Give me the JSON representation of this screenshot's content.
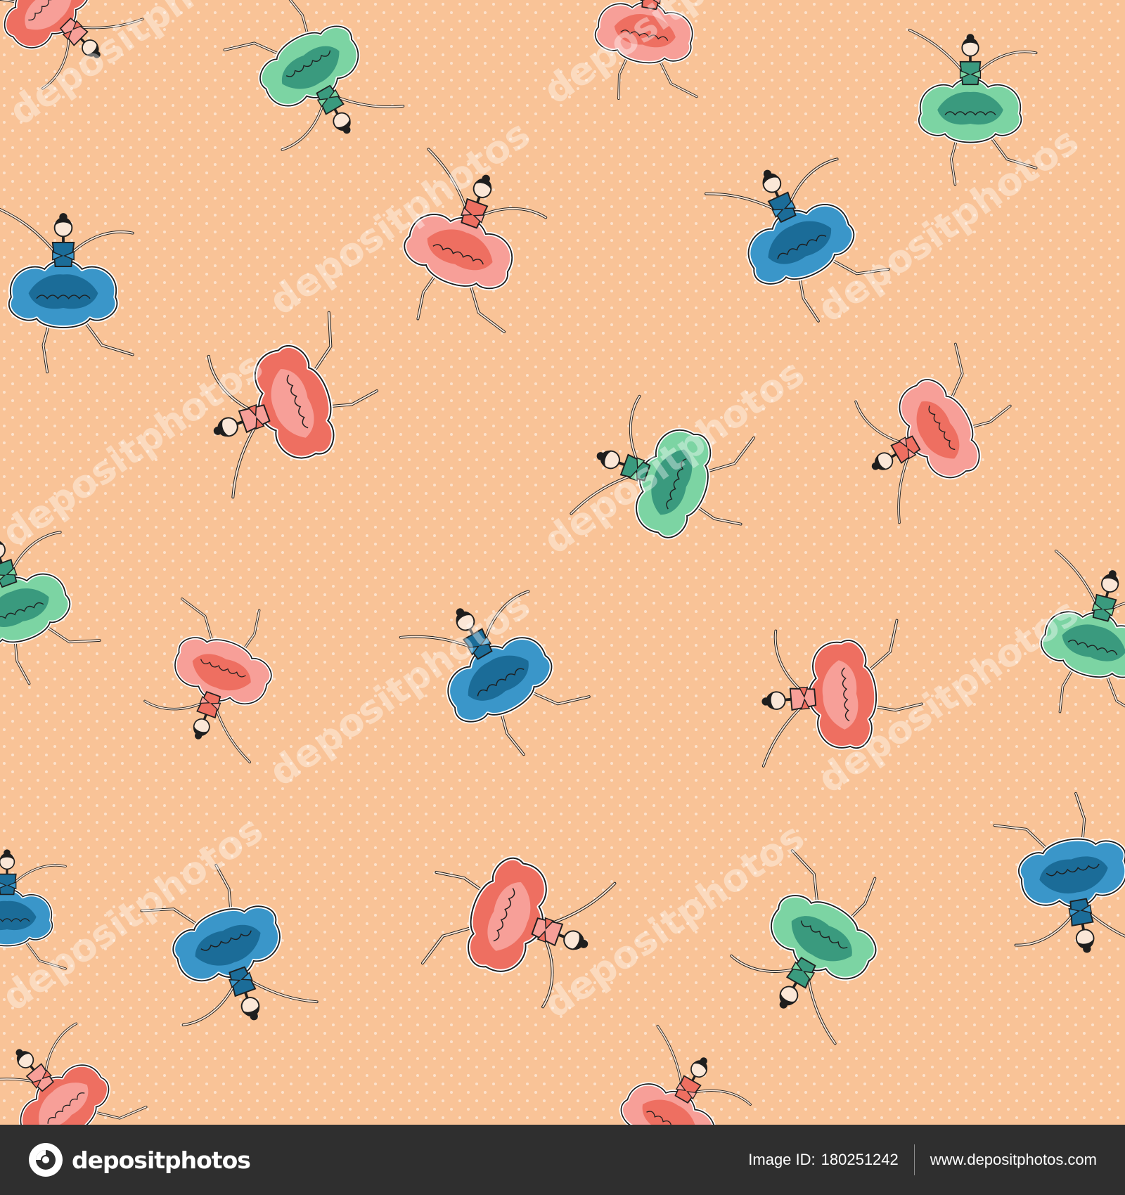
{
  "watermark": {
    "text": "depositphotos"
  },
  "footer": {
    "logo_text": "depositphotos",
    "image_id_label": "Image ID:",
    "image_id": "180251242",
    "site_url": "www.depositphotos.com"
  },
  "colors": {
    "background": "#f9c397",
    "dots": "#ffffff",
    "footer_bg": "#2f2f2f",
    "coral": "#ee6f61",
    "pink": "#f79f98",
    "blue": "#3a96c9",
    "navy": "#1b6c98",
    "mint": "#7cd4a3",
    "teal": "#3a9a7e",
    "skin": "#fbe7d7"
  }
}
